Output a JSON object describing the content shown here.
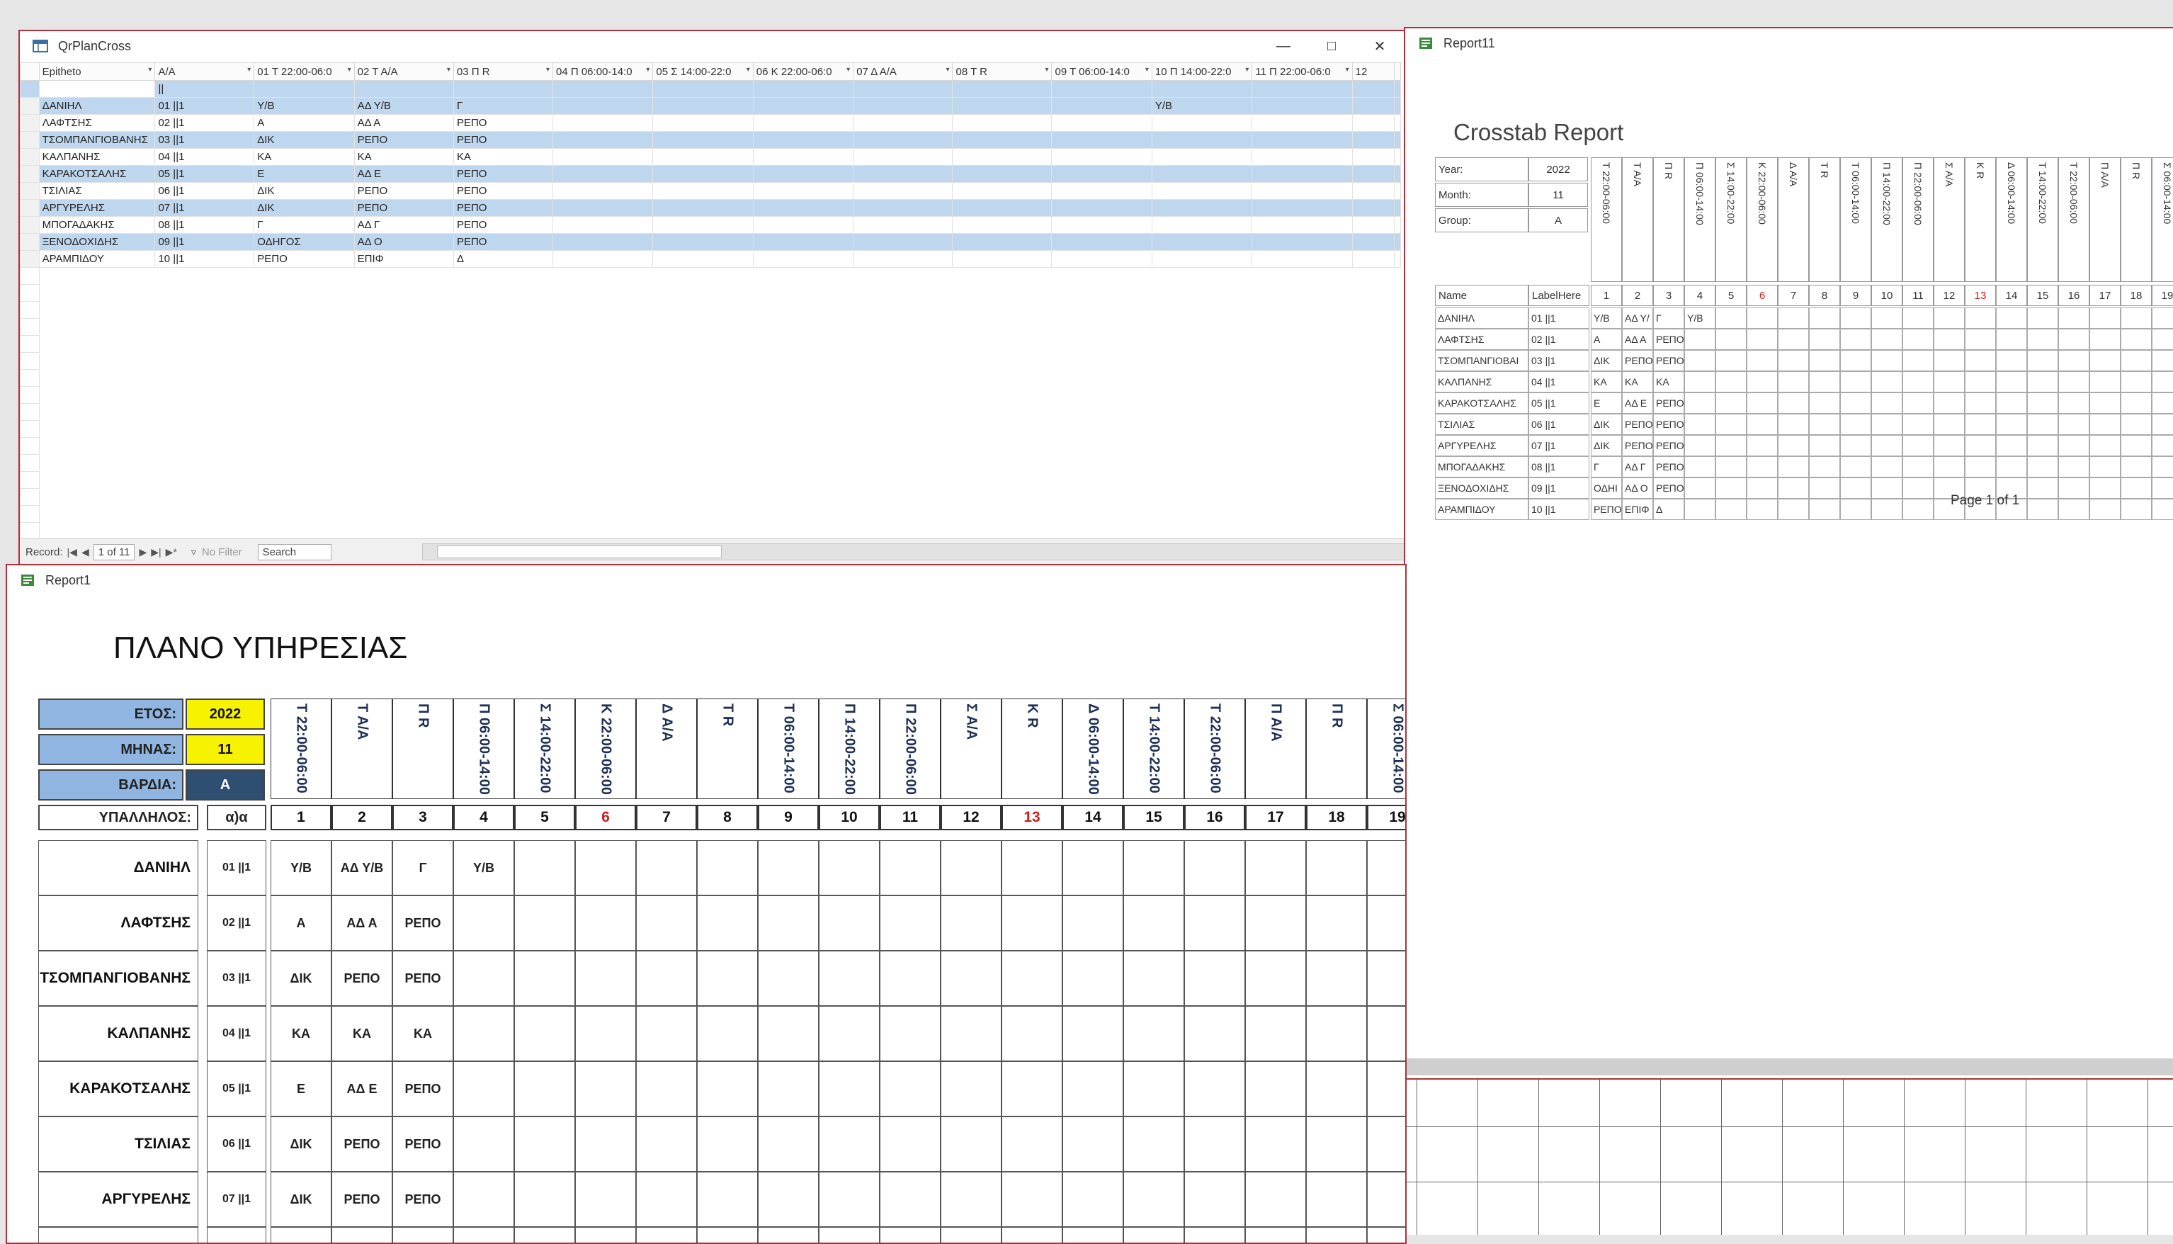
{
  "qwin": {
    "title": "QrPlanCross",
    "columns": [
      "Epitheto",
      "Α/Α",
      "01 Τ 22:00-06:0",
      "02 Τ Α/Α",
      "03 Π R",
      "04 Π 06:00-14:0",
      "05 Σ 14:00-22:0",
      "06 Κ 22:00-06:0",
      "07 Δ Α/Α",
      "08 Τ R",
      "09 Τ 06:00-14:0",
      "10 Π 14:00-22:0",
      "11 Π 22:00-06:0",
      "12"
    ],
    "filter_row": [
      "",
      "||",
      "",
      "",
      "",
      "",
      "",
      "",
      "",
      "",
      "",
      "",
      "",
      ""
    ],
    "rows": [
      [
        "ΔΑΝΙΗΛ",
        "01 ||1",
        "Υ/Β",
        "ΑΔ Υ/Β",
        "Γ",
        "",
        "",
        "",
        "",
        "",
        "",
        "Υ/Β",
        "",
        ""
      ],
      [
        "ΛΑΦΤΣΗΣ",
        "02 ||1",
        "Α",
        "ΑΔ Α",
        "ΡΕΠΟ",
        "",
        "",
        "",
        "",
        "",
        "",
        "",
        "",
        ""
      ],
      [
        "ΤΣΟΜΠΑΝΓΙΟΒΑΝΗΣ",
        "03 ||1",
        "ΔΙΚ",
        "ΡΕΠΟ",
        "ΡΕΠΟ",
        "",
        "",
        "",
        "",
        "",
        "",
        "",
        "",
        ""
      ],
      [
        "ΚΑΛΠΑΝΗΣ",
        "04 ||1",
        "ΚΑ",
        "ΚΑ",
        "ΚΑ",
        "",
        "",
        "",
        "",
        "",
        "",
        "",
        "",
        ""
      ],
      [
        "ΚΑΡΑΚΟΤΣΑΛΗΣ",
        "05 ||1",
        "Ε",
        "ΑΔ Ε",
        "ΡΕΠΟ",
        "",
        "",
        "",
        "",
        "",
        "",
        "",
        "",
        ""
      ],
      [
        "ΤΣΙΛΙΑΣ",
        "06 ||1",
        "ΔΙΚ",
        "ΡΕΠΟ",
        "ΡΕΠΟ",
        "",
        "",
        "",
        "",
        "",
        "",
        "",
        "",
        ""
      ],
      [
        "ΑΡΓΥΡΕΛΗΣ",
        "07 ||1",
        "ΔΙΚ",
        "ΡΕΠΟ",
        "ΡΕΠΟ",
        "",
        "",
        "",
        "",
        "",
        "",
        "",
        "",
        ""
      ],
      [
        "ΜΠΟΓΑΔΑΚΗΣ",
        "08 ||1",
        "Γ",
        "ΑΔ Γ",
        "ΡΕΠΟ",
        "",
        "",
        "",
        "",
        "",
        "",
        "",
        "",
        ""
      ],
      [
        "ΞΕΝΟΔΟΧΙΔΗΣ",
        "09 ||1",
        "ΟΔΗΓΟΣ",
        "ΑΔ Ο",
        "ΡΕΠΟ",
        "",
        "",
        "",
        "",
        "",
        "",
        "",
        "",
        ""
      ],
      [
        "ΑΡΑΜΠΙΔΟΥ",
        "10 ||1",
        "ΡΕΠΟ",
        "ΕΠΙΦ",
        "Δ",
        "",
        "",
        "",
        "",
        "",
        "",
        "",
        "",
        ""
      ]
    ],
    "status": {
      "record_label": "Record:",
      "record_value": "1 of 11",
      "filter": "No Filter",
      "search": "Search"
    }
  },
  "r1": {
    "window_title": "Report1",
    "title": "ΠΛΑΝΟ ΥΠΗΡΕΣΙΑΣ",
    "year_label": "ΕΤΟΣ:",
    "year": "2022",
    "month_label": "ΜΗΝΑΣ:",
    "month": "11",
    "shift_label": "ΒΑΡΔΙΑ:",
    "shift": "Α",
    "employee_label": "ΥΠΑΛΛΗΛΟΣ:",
    "aa_label": "α)α",
    "day_headers": [
      "Τ 22:00-06:00",
      "Τ Α/Α",
      "Π R",
      "Π 06:00-14:00",
      "Σ 14:00-22:00",
      "Κ 22:00-06:00",
      "Δ Α/Α",
      "Τ R",
      "Τ 06:00-14:00",
      "Π 14:00-22:00",
      "Π 22:00-06:00",
      "Σ Α/Α",
      "Κ R",
      "Δ 06:00-14:00",
      "Τ 14:00-22:00",
      "Τ 22:00-06:00",
      "Π Α/Α",
      "Π R",
      "Σ 06:00-14:00"
    ],
    "days": [
      "1",
      "2",
      "3",
      "4",
      "5",
      "6",
      "7",
      "8",
      "9",
      "10",
      "11",
      "12",
      "13",
      "14",
      "15",
      "16",
      "17",
      "18",
      "19"
    ],
    "red_days": [
      5,
      12
    ],
    "rows": [
      {
        "name": "ΔΑΝΙΗΛ",
        "aa": "01 ||1",
        "cells": [
          "Υ/Β",
          "ΑΔ Υ/Β",
          "Γ",
          "Υ/Β"
        ]
      },
      {
        "name": "ΛΑΦΤΣΗΣ",
        "aa": "02 ||1",
        "cells": [
          "Α",
          "ΑΔ Α",
          "ΡΕΠΟ"
        ]
      },
      {
        "name": "ΤΣΟΜΠΑΝΓΙΟΒΑΝΗΣ",
        "aa": "03 ||1",
        "cells": [
          "ΔΙΚ",
          "ΡΕΠΟ",
          "ΡΕΠΟ"
        ]
      },
      {
        "name": "ΚΑΛΠΑΝΗΣ",
        "aa": "04 ||1",
        "cells": [
          "ΚΑ",
          "ΚΑ",
          "ΚΑ"
        ]
      },
      {
        "name": "ΚΑΡΑΚΟΤΣΑΛΗΣ",
        "aa": "05 ||1",
        "cells": [
          "Ε",
          "ΑΔ Ε",
          "ΡΕΠΟ"
        ]
      },
      {
        "name": "ΤΣΙΛΙΑΣ",
        "aa": "06 ||1",
        "cells": [
          "ΔΙΚ",
          "ΡΕΠΟ",
          "ΡΕΠΟ"
        ]
      },
      {
        "name": "ΑΡΓΥΡΕΛΗΣ",
        "aa": "07 ||1",
        "cells": [
          "ΔΙΚ",
          "ΡΕΠΟ",
          "ΡΕΠΟ"
        ]
      }
    ]
  },
  "r11": {
    "window_title": "Report11",
    "title": "Crosstab Report",
    "year_label": "Year:",
    "year": "2022",
    "month_label": "Month:",
    "month": "11",
    "group_label": "Group:",
    "group": "A",
    "name_label": "Name",
    "labelhere": "LabelHere",
    "day_headers": [
      "Τ 22:00-06:00",
      "Τ Α/Α",
      "Π R",
      "Π 06:00-14:00",
      "Σ 14:00-22:00",
      "Κ 22:00-06:00",
      "Δ Α/Α",
      "Τ R",
      "Τ 06:00-14:00",
      "Π 14:00-22:00",
      "Π 22:00-06:00",
      "Σ Α/Α",
      "Κ R",
      "Δ 06:00-14:00",
      "Τ 14:00-22:00",
      "Τ 22:00-06:00",
      "Π Α/Α",
      "Π R",
      "Σ 06:00-14:00"
    ],
    "days": [
      "1",
      "2",
      "3",
      "4",
      "5",
      "6",
      "7",
      "8",
      "9",
      "10",
      "11",
      "12",
      "13",
      "14",
      "15",
      "16",
      "17",
      "18",
      "19"
    ],
    "red_days": [
      5,
      12
    ],
    "rows": [
      {
        "name": "ΔΑΝΙΗΛ",
        "aa": "01 ||1",
        "cells": [
          "Υ/Β",
          "ΑΔ Υ/",
          "Γ",
          "Υ/Β"
        ]
      },
      {
        "name": "ΛΑΦΤΣΗΣ",
        "aa": "02 ||1",
        "cells": [
          "Α",
          "ΑΔ Α",
          "ΡΕΠΟ"
        ]
      },
      {
        "name": "ΤΣΟΜΠΑΝΓΙΟΒΑΙ",
        "aa": "03 ||1",
        "cells": [
          "ΔΙΚ",
          "ΡΕΠΟ",
          "ΡΕΠΟ"
        ]
      },
      {
        "name": "ΚΑΛΠΑΝΗΣ",
        "aa": "04 ||1",
        "cells": [
          "ΚΑ",
          "ΚΑ",
          "ΚΑ"
        ]
      },
      {
        "name": "ΚΑΡΑΚΟΤΣΑΛΗΣ",
        "aa": "05 ||1",
        "cells": [
          "Ε",
          "ΑΔ Ε",
          "ΡΕΠΟ"
        ]
      },
      {
        "name": "ΤΣΙΛΙΑΣ",
        "aa": "06 ||1",
        "cells": [
          "ΔΙΚ",
          "ΡΕΠΟ",
          "ΡΕΠΟ"
        ]
      },
      {
        "name": "ΑΡΓΥΡΕΛΗΣ",
        "aa": "07 ||1",
        "cells": [
          "ΔΙΚ",
          "ΡΕΠΟ",
          "ΡΕΠΟ"
        ]
      },
      {
        "name": "ΜΠΟΓΑΔΑΚΗΣ",
        "aa": "08 ||1",
        "cells": [
          "Γ",
          "ΑΔ Γ",
          "ΡΕΠΟ"
        ]
      },
      {
        "name": "ΞΕΝΟΔΟΧΙΔΗΣ",
        "aa": "09 ||1",
        "cells": [
          "ΟΔΗΙ",
          "ΑΔ Ο",
          "ΡΕΠΟ"
        ]
      },
      {
        "name": "ΑΡΑΜΠΙΔΟΥ",
        "aa": "10 ||1",
        "cells": [
          "ΡΕΠΟ",
          "ΕΠΙΦ",
          "Δ"
        ]
      }
    ],
    "page_footer": "Page 1 of 1"
  }
}
